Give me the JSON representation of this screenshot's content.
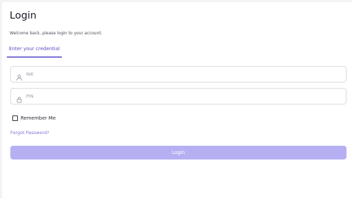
{
  "page": {
    "title": "Login",
    "subtitle": "Welcome back, please login to your account."
  },
  "tabs": [
    {
      "label": "Enter your credential",
      "active": true
    }
  ],
  "form": {
    "nik": {
      "placeholder": "NIK",
      "value": "",
      "icon": "user-icon"
    },
    "pin": {
      "placeholder": "PIN",
      "value": "",
      "icon": "lock-icon"
    },
    "remember": {
      "label": "Remember Me",
      "checked": false
    },
    "forgot_label": "Forgot Password?",
    "submit_label": "Login"
  },
  "colors": {
    "accent": "#7b6fd6",
    "button_bg": "#b6b0f3",
    "field_border": "#dcdce3"
  }
}
